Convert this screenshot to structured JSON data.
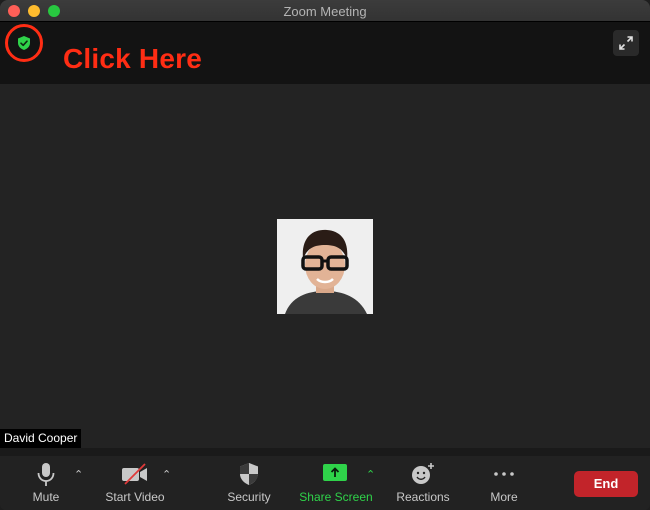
{
  "window": {
    "title": "Zoom Meeting"
  },
  "header": {
    "security_status": "encrypted",
    "annotation_text": "Click Here",
    "annotation_color": "#ff2d14",
    "security_color": "#2fd34a"
  },
  "main": {
    "participant_name": "David Cooper"
  },
  "toolbar": {
    "items": [
      {
        "label": "Mute",
        "icon": "microphone-icon"
      },
      {
        "label": "Start Video",
        "icon": "video-off-icon"
      },
      {
        "label": "Security",
        "icon": "shield-icon"
      },
      {
        "label": "Share Screen",
        "icon": "share-screen-icon"
      },
      {
        "label": "Reactions",
        "icon": "reactions-icon"
      },
      {
        "label": "More",
        "icon": "more-icon"
      }
    ],
    "end_label": "End",
    "accent_color": "#2fd34a",
    "end_color": "#c2242a"
  }
}
